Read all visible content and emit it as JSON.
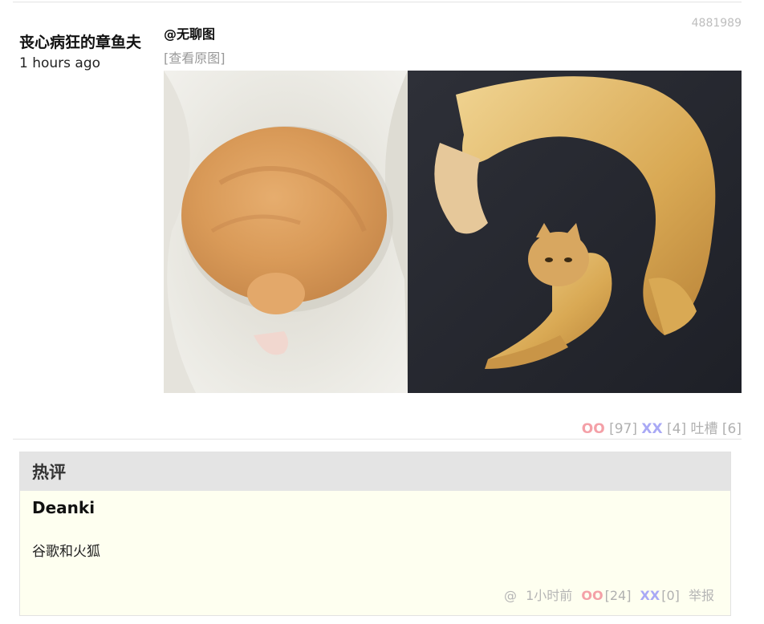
{
  "post": {
    "id": "4881989",
    "author": "丧心病狂的章鱼夫",
    "time": "1 hours ago",
    "mention": "@无聊图",
    "view_original": "[查看原图]",
    "image_left_icon": "curled-orange-cat-photo",
    "image_right_icon": "stretched-fluffy-cat-photo",
    "votes": {
      "oo_label": "OO",
      "oo_count": "[97]",
      "xx_label": "XX",
      "xx_count": "[4]",
      "tucao_label": "吐槽",
      "tucao_count": "[6]"
    }
  },
  "hot_comments": {
    "title": "热评",
    "comment": {
      "author": "Deanki",
      "text": "谷歌和火狐",
      "at": "@",
      "time": "1小时前",
      "oo_label": "OO",
      "oo_count": "[24]",
      "xx_label": "XX",
      "xx_count": "[0]",
      "report": "举报"
    }
  },
  "colors": {
    "oo": "#f4a0a7",
    "xx": "#a9a9f5",
    "muted": "#b0b0b0",
    "hot_bg": "#fefff0",
    "hot_header_bg": "#e4e4e4"
  }
}
